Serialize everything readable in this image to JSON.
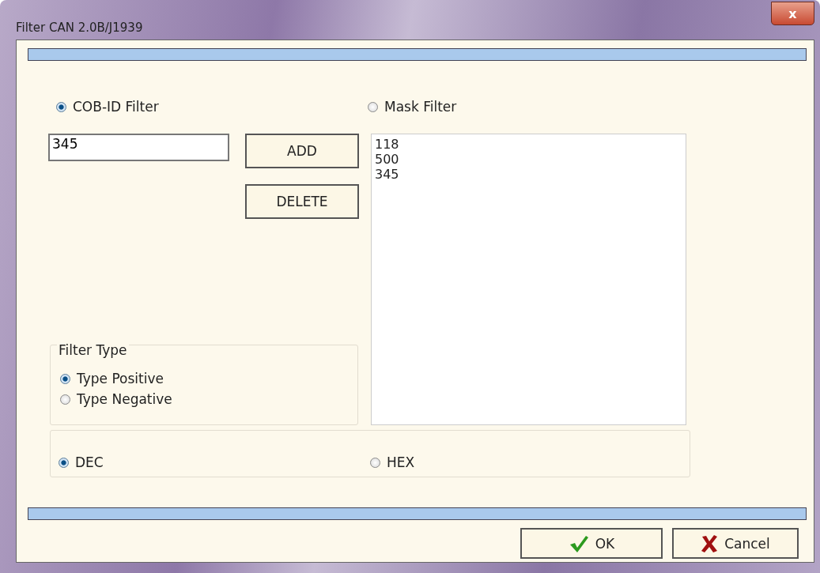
{
  "window": {
    "title": "Filter CAN 2.0B/J1939",
    "close": "x"
  },
  "filter_modes": [
    {
      "label": "COB-ID Filter",
      "selected": true
    },
    {
      "label": "Mask Filter",
      "selected": false
    }
  ],
  "id_field": {
    "value": "345"
  },
  "edit_buttons": [
    "ADD",
    "DELETE"
  ],
  "id_list": [
    "118",
    "500",
    "345"
  ],
  "filter_type": {
    "legend": "Filter Type",
    "options": [
      {
        "label": "Type Positive",
        "selected": true
      },
      {
        "label": "Type Negative",
        "selected": false
      }
    ]
  },
  "number_formats": [
    {
      "label": "DEC",
      "selected": true
    },
    {
      "label": "HEX",
      "selected": false
    }
  ],
  "dialog_buttons": [
    {
      "kind": "ok",
      "label": "OK"
    },
    {
      "kind": "cancel",
      "label": "Cancel"
    }
  ]
}
